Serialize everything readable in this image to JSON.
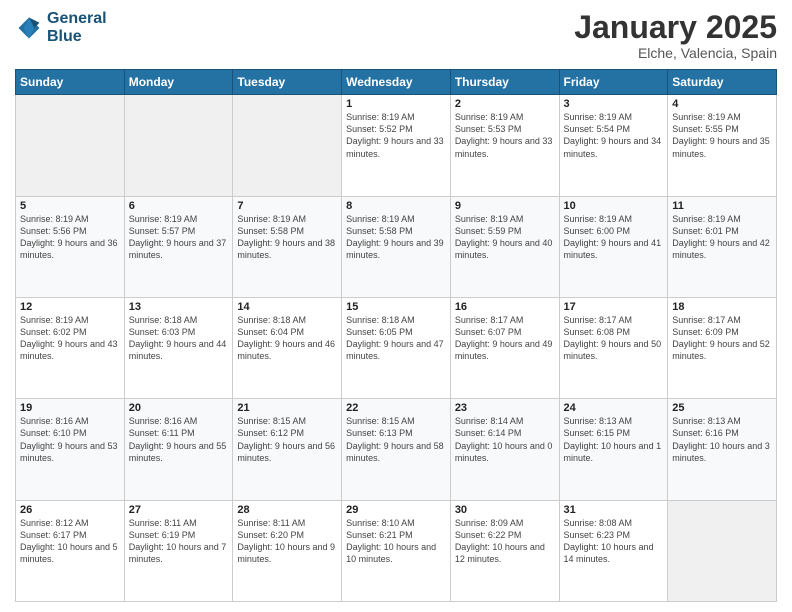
{
  "header": {
    "logo_line1": "General",
    "logo_line2": "Blue",
    "month": "January 2025",
    "location": "Elche, Valencia, Spain"
  },
  "days_header": [
    "Sunday",
    "Monday",
    "Tuesday",
    "Wednesday",
    "Thursday",
    "Friday",
    "Saturday"
  ],
  "weeks": [
    [
      {
        "day": "",
        "info": ""
      },
      {
        "day": "",
        "info": ""
      },
      {
        "day": "",
        "info": ""
      },
      {
        "day": "1",
        "info": "Sunrise: 8:19 AM\nSunset: 5:52 PM\nDaylight: 9 hours and 33 minutes."
      },
      {
        "day": "2",
        "info": "Sunrise: 8:19 AM\nSunset: 5:53 PM\nDaylight: 9 hours and 33 minutes."
      },
      {
        "day": "3",
        "info": "Sunrise: 8:19 AM\nSunset: 5:54 PM\nDaylight: 9 hours and 34 minutes."
      },
      {
        "day": "4",
        "info": "Sunrise: 8:19 AM\nSunset: 5:55 PM\nDaylight: 9 hours and 35 minutes."
      }
    ],
    [
      {
        "day": "5",
        "info": "Sunrise: 8:19 AM\nSunset: 5:56 PM\nDaylight: 9 hours and 36 minutes."
      },
      {
        "day": "6",
        "info": "Sunrise: 8:19 AM\nSunset: 5:57 PM\nDaylight: 9 hours and 37 minutes."
      },
      {
        "day": "7",
        "info": "Sunrise: 8:19 AM\nSunset: 5:58 PM\nDaylight: 9 hours and 38 minutes."
      },
      {
        "day": "8",
        "info": "Sunrise: 8:19 AM\nSunset: 5:58 PM\nDaylight: 9 hours and 39 minutes."
      },
      {
        "day": "9",
        "info": "Sunrise: 8:19 AM\nSunset: 5:59 PM\nDaylight: 9 hours and 40 minutes."
      },
      {
        "day": "10",
        "info": "Sunrise: 8:19 AM\nSunset: 6:00 PM\nDaylight: 9 hours and 41 minutes."
      },
      {
        "day": "11",
        "info": "Sunrise: 8:19 AM\nSunset: 6:01 PM\nDaylight: 9 hours and 42 minutes."
      }
    ],
    [
      {
        "day": "12",
        "info": "Sunrise: 8:19 AM\nSunset: 6:02 PM\nDaylight: 9 hours and 43 minutes."
      },
      {
        "day": "13",
        "info": "Sunrise: 8:18 AM\nSunset: 6:03 PM\nDaylight: 9 hours and 44 minutes."
      },
      {
        "day": "14",
        "info": "Sunrise: 8:18 AM\nSunset: 6:04 PM\nDaylight: 9 hours and 46 minutes."
      },
      {
        "day": "15",
        "info": "Sunrise: 8:18 AM\nSunset: 6:05 PM\nDaylight: 9 hours and 47 minutes."
      },
      {
        "day": "16",
        "info": "Sunrise: 8:17 AM\nSunset: 6:07 PM\nDaylight: 9 hours and 49 minutes."
      },
      {
        "day": "17",
        "info": "Sunrise: 8:17 AM\nSunset: 6:08 PM\nDaylight: 9 hours and 50 minutes."
      },
      {
        "day": "18",
        "info": "Sunrise: 8:17 AM\nSunset: 6:09 PM\nDaylight: 9 hours and 52 minutes."
      }
    ],
    [
      {
        "day": "19",
        "info": "Sunrise: 8:16 AM\nSunset: 6:10 PM\nDaylight: 9 hours and 53 minutes."
      },
      {
        "day": "20",
        "info": "Sunrise: 8:16 AM\nSunset: 6:11 PM\nDaylight: 9 hours and 55 minutes."
      },
      {
        "day": "21",
        "info": "Sunrise: 8:15 AM\nSunset: 6:12 PM\nDaylight: 9 hours and 56 minutes."
      },
      {
        "day": "22",
        "info": "Sunrise: 8:15 AM\nSunset: 6:13 PM\nDaylight: 9 hours and 58 minutes."
      },
      {
        "day": "23",
        "info": "Sunrise: 8:14 AM\nSunset: 6:14 PM\nDaylight: 10 hours and 0 minutes."
      },
      {
        "day": "24",
        "info": "Sunrise: 8:13 AM\nSunset: 6:15 PM\nDaylight: 10 hours and 1 minute."
      },
      {
        "day": "25",
        "info": "Sunrise: 8:13 AM\nSunset: 6:16 PM\nDaylight: 10 hours and 3 minutes."
      }
    ],
    [
      {
        "day": "26",
        "info": "Sunrise: 8:12 AM\nSunset: 6:17 PM\nDaylight: 10 hours and 5 minutes."
      },
      {
        "day": "27",
        "info": "Sunrise: 8:11 AM\nSunset: 6:19 PM\nDaylight: 10 hours and 7 minutes."
      },
      {
        "day": "28",
        "info": "Sunrise: 8:11 AM\nSunset: 6:20 PM\nDaylight: 10 hours and 9 minutes."
      },
      {
        "day": "29",
        "info": "Sunrise: 8:10 AM\nSunset: 6:21 PM\nDaylight: 10 hours and 10 minutes."
      },
      {
        "day": "30",
        "info": "Sunrise: 8:09 AM\nSunset: 6:22 PM\nDaylight: 10 hours and 12 minutes."
      },
      {
        "day": "31",
        "info": "Sunrise: 8:08 AM\nSunset: 6:23 PM\nDaylight: 10 hours and 14 minutes."
      },
      {
        "day": "",
        "info": ""
      }
    ]
  ]
}
